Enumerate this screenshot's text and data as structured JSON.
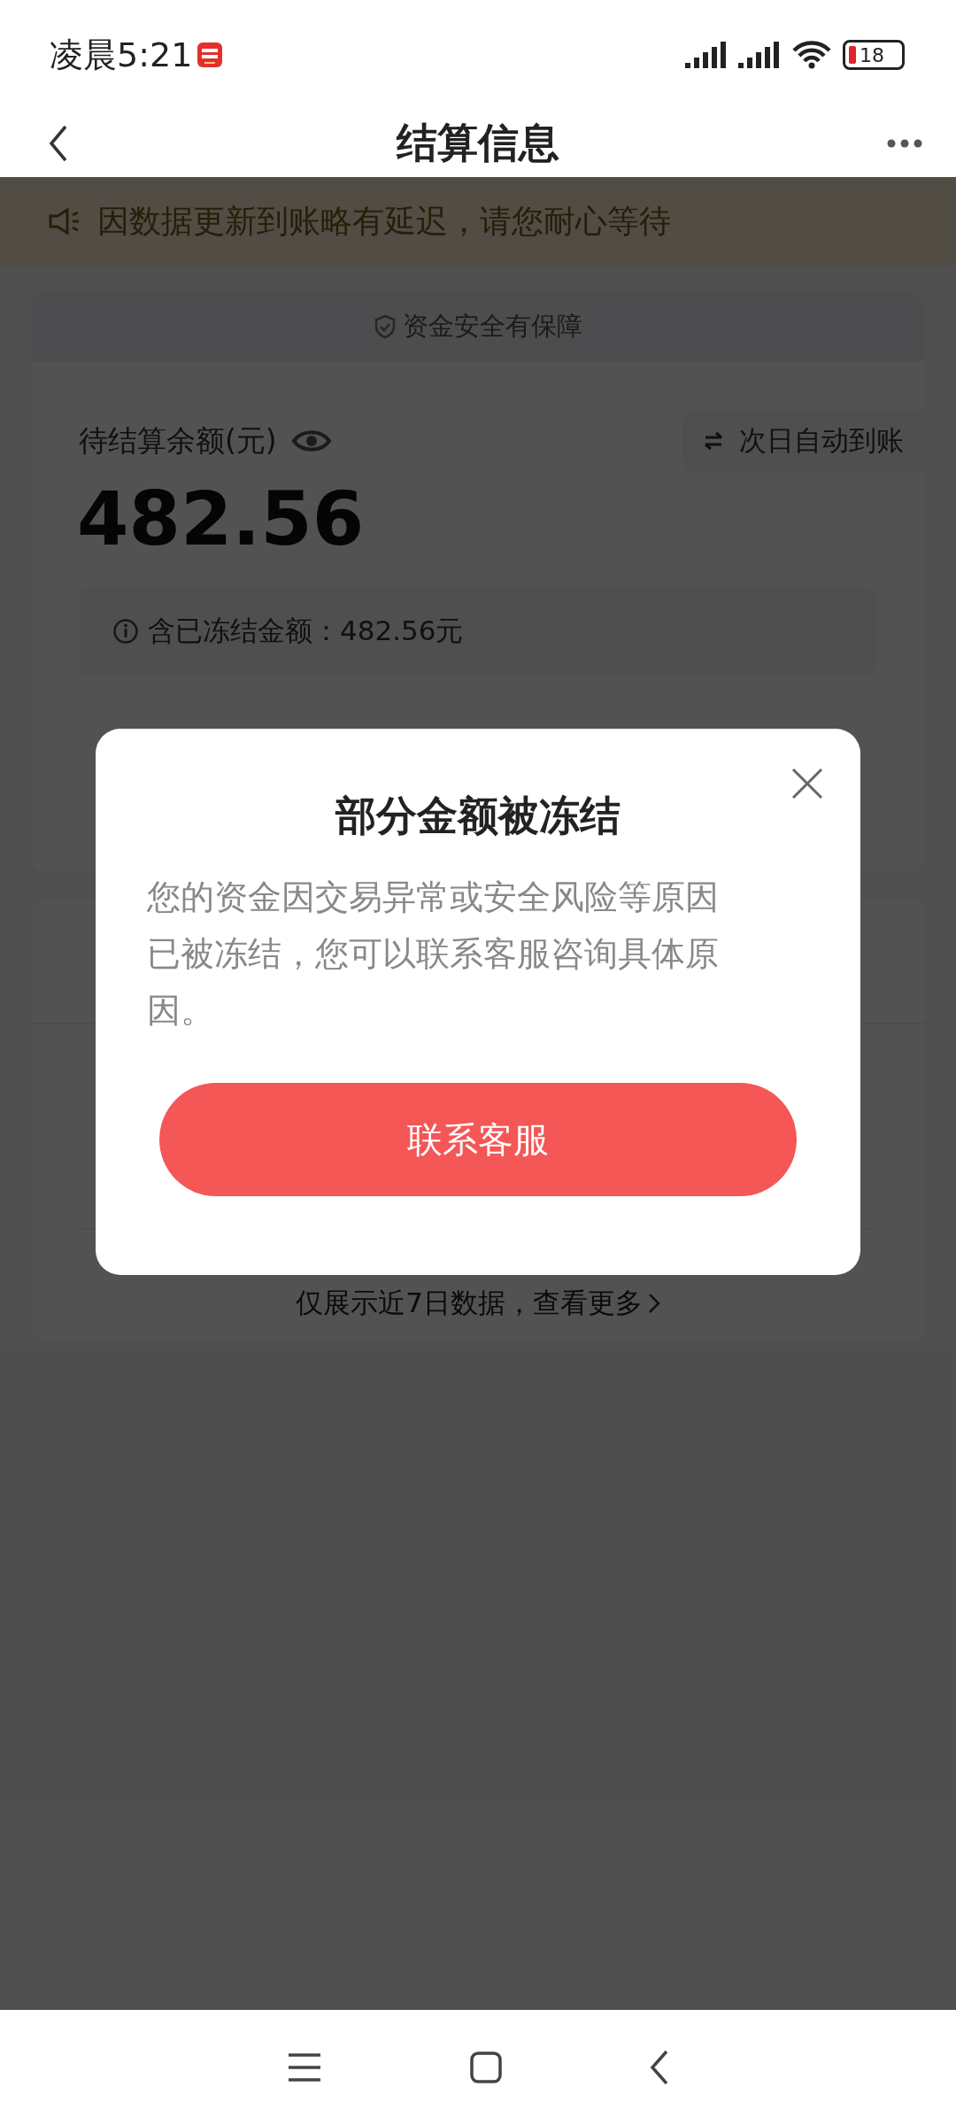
{
  "status_bar": {
    "time": "凌晨5:21",
    "battery": "18"
  },
  "header": {
    "title": "结算信息"
  },
  "notice": {
    "text": "因数据更新到账略有延迟，请您耐心等待"
  },
  "balance_card": {
    "security": "资金安全有保障",
    "label": "待结算余额(元)",
    "amount": "482.56",
    "auto_settle": "次日自动到账",
    "frozen_note": "含已冻结金额：482.56元"
  },
  "records": {
    "footer": "仅展示近7日数据，查看更多"
  },
  "dialog": {
    "title": "部分金额被冻结",
    "body": "您的资金因交易异常或安全风险等原因已被冻结，您可以联系客服咨询具体原因。",
    "button": "联系客服"
  }
}
